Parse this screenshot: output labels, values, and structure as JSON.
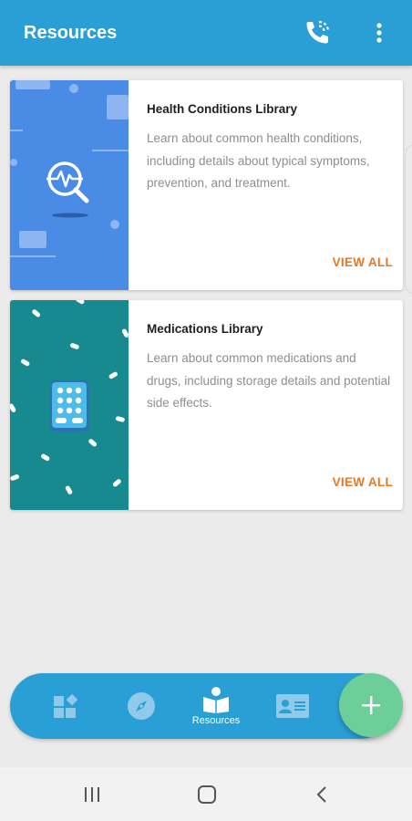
{
  "appbar": {
    "title": "Resources",
    "icons": {
      "call": "phone-calling-icon",
      "menu": "more-vert-icon"
    }
  },
  "cards": [
    {
      "title": "Health Conditions Library",
      "description": "Learn about common health conditions, including details about typical symptoms, prevention, and treatment.",
      "action": "VIEW ALL",
      "art_color": "#4a8be6",
      "icon": "health-search-icon"
    },
    {
      "title": "Medications Library",
      "description": "Learn about common medications and drugs, including storage details and potential side effects.",
      "action": "VIEW ALL",
      "art_color": "#168a8e",
      "icon": "pill-pack-icon"
    }
  ],
  "bottom_nav": {
    "items": [
      {
        "icon": "dashboard-icon",
        "label": ""
      },
      {
        "icon": "compass-icon",
        "label": ""
      },
      {
        "icon": "resources-book-icon",
        "label": "Resources"
      },
      {
        "icon": "id-card-icon",
        "label": ""
      }
    ],
    "active_index": 2,
    "fab_icon": "plus-icon"
  },
  "colors": {
    "primary": "#2a9fd6",
    "accent": "#e87722",
    "fab": "#6ccf9a"
  }
}
